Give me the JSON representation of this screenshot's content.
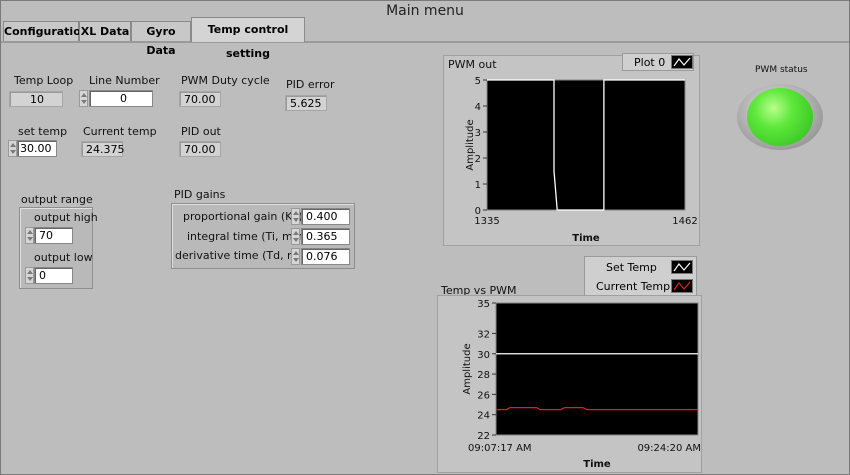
{
  "window": {
    "title": "Main menu"
  },
  "tabs": [
    {
      "label": "Configuration"
    },
    {
      "label": "XL Data"
    },
    {
      "label": "Gyro Data"
    },
    {
      "label": "Temp control setting"
    }
  ],
  "fields": {
    "temp_loop": {
      "label": "Temp Loop",
      "value": "10"
    },
    "line_number": {
      "label": "Line Number",
      "value": "0"
    },
    "pwm_duty_cycle": {
      "label": "PWM Duty cycle",
      "value": "70.00"
    },
    "pid_error": {
      "label": "PID error",
      "value": "5.625"
    },
    "set_temp": {
      "label": "set temp",
      "value": "30.00"
    },
    "current_temp": {
      "label": "Current temp",
      "value": "24.375"
    },
    "pid_out": {
      "label": "PID out",
      "value": "70.00"
    }
  },
  "output_range": {
    "label": "output range",
    "high_label": "output high",
    "high_value": "70",
    "low_label": "output low",
    "low_value": "0"
  },
  "pid_gains": {
    "label": "PID gains",
    "kc_label": "proportional gain (Kc)",
    "kc_value": "0.400",
    "ti_label": "integral time (Ti, min)",
    "ti_value": "0.365",
    "td_label": "derivative time (Td, min)",
    "td_value": "0.076"
  },
  "pwm_status": {
    "label": "PWM status",
    "color": "#3ddc2a"
  },
  "chart_data": [
    {
      "type": "line",
      "title": "PWM out",
      "xlabel": "Time",
      "ylabel": "Amplitude",
      "xlim": [
        1335,
        1462
      ],
      "ylim": [
        0,
        5
      ],
      "xtick_labels": [
        "1335",
        "1462"
      ],
      "ytick_labels": [
        "0",
        "1",
        "2",
        "3",
        "4",
        "5"
      ],
      "legend": "top-right",
      "series": [
        {
          "name": "Plot 0",
          "color": "#ffffff",
          "x": [
            1335,
            1378,
            1378,
            1380,
            1380,
            1410,
            1410,
            1462
          ],
          "y": [
            5,
            5,
            1.5,
            0,
            0,
            0,
            5,
            5
          ]
        }
      ]
    },
    {
      "type": "line",
      "title": "Temp vs PWM",
      "xlabel": "Time",
      "ylabel": "Amplitude",
      "xtick_labels": [
        "09:07:17 AM",
        "09:24:20 AM"
      ],
      "ytick_labels": [
        "22",
        "24",
        "26",
        "28",
        "30",
        "32",
        "35"
      ],
      "ylim": [
        22,
        35
      ],
      "legend": "top-right",
      "series": [
        {
          "name": "Set Temp",
          "color": "#ffffff",
          "x": [
            "09:07:17 AM",
            "09:24:20 AM"
          ],
          "y": [
            30,
            30
          ]
        },
        {
          "name": "Current Temp",
          "color": "#e02020",
          "x_frac": [
            0,
            0.05,
            0.07,
            0.2,
            0.22,
            0.32,
            0.34,
            0.43,
            0.45,
            1
          ],
          "y": [
            24.5,
            24.5,
            24.7,
            24.7,
            24.5,
            24.5,
            24.7,
            24.7,
            24.5,
            24.5
          ]
        }
      ]
    }
  ]
}
